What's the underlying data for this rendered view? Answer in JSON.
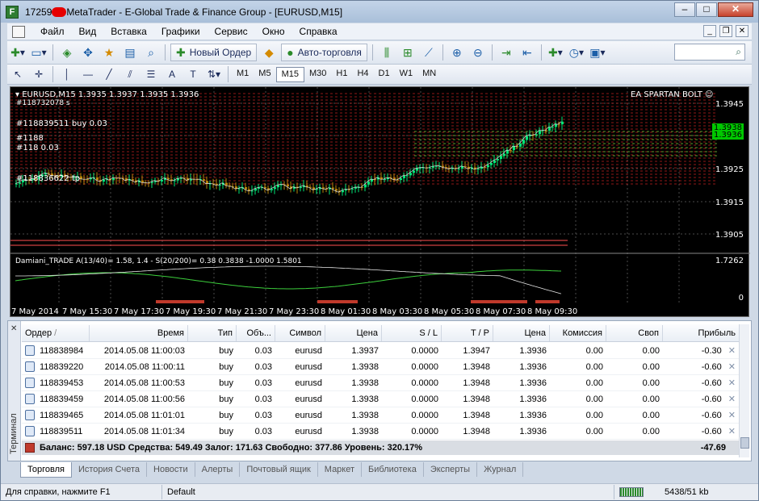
{
  "window": {
    "title_prefix": "17259",
    "title_rest": "MetaTrader - E-Global Trade & Finance Group - [EURUSD,M15]"
  },
  "menu": [
    "Файл",
    "Вид",
    "Вставка",
    "Графики",
    "Сервис",
    "Окно",
    "Справка"
  ],
  "toolbar": {
    "new_order": "Новый Ордер",
    "autotrading": "Авто-торговля",
    "timeframes": [
      "M1",
      "M5",
      "M15",
      "M30",
      "H1",
      "H4",
      "D1",
      "W1",
      "MN"
    ],
    "active_timeframe": "M15"
  },
  "chart": {
    "symbol_info": "EURUSD,M15  1.3935 1.3937 1.3935 1.3936",
    "ea_name": "EA SPARTAN BOLT",
    "order_labels": [
      "#118732078 s",
      "#118839511 buy 0.03",
      "#1188",
      "#118 0.03",
      "#118836622 tp"
    ],
    "price_labels": [
      "1.3945",
      "1.3938",
      "1.3936",
      "1.3925",
      "1.3915",
      "1.3905"
    ],
    "indicator_label": "Damiani_TRADE  A(13/40)= 1.58, 1.4 - S(20/200)= 0.38  0.3838 -1.0000 1.5801",
    "indicator_scale": [
      "1.7262",
      "0"
    ],
    "time_labels": [
      "7 May 2014",
      "7 May 15:30",
      "7 May 17:30",
      "7 May 19:30",
      "7 May 21:30",
      "7 May 23:30",
      "8 May 01:30",
      "8 May 03:30",
      "8 May 05:30",
      "8 May 07:30",
      "8 May 09:30"
    ]
  },
  "terminal": {
    "side_label": "Терминал",
    "columns": [
      "Ордер",
      "Время",
      "Тип",
      "Объ...",
      "Символ",
      "Цена",
      "S / L",
      "T / P",
      "Цена",
      "Комиссия",
      "Своп",
      "Прибыль"
    ],
    "rows": [
      {
        "order": "118838984",
        "time": "2014.05.08 11:00:03",
        "type": "buy",
        "volume": "0.03",
        "symbol": "eurusd",
        "price": "1.3937",
        "sl": "0.0000",
        "tp": "1.3947",
        "cur": "1.3936",
        "commission": "0.00",
        "swap": "0.00",
        "profit": "-0.30"
      },
      {
        "order": "118839220",
        "time": "2014.05.08 11:00:11",
        "type": "buy",
        "volume": "0.03",
        "symbol": "eurusd",
        "price": "1.3938",
        "sl": "0.0000",
        "tp": "1.3948",
        "cur": "1.3936",
        "commission": "0.00",
        "swap": "0.00",
        "profit": "-0.60"
      },
      {
        "order": "118839453",
        "time": "2014.05.08 11:00:53",
        "type": "buy",
        "volume": "0.03",
        "symbol": "eurusd",
        "price": "1.3938",
        "sl": "0.0000",
        "tp": "1.3948",
        "cur": "1.3936",
        "commission": "0.00",
        "swap": "0.00",
        "profit": "-0.60"
      },
      {
        "order": "118839459",
        "time": "2014.05.08 11:00:56",
        "type": "buy",
        "volume": "0.03",
        "symbol": "eurusd",
        "price": "1.3938",
        "sl": "0.0000",
        "tp": "1.3948",
        "cur": "1.3936",
        "commission": "0.00",
        "swap": "0.00",
        "profit": "-0.60"
      },
      {
        "order": "118839465",
        "time": "2014.05.08 11:01:01",
        "type": "buy",
        "volume": "0.03",
        "symbol": "eurusd",
        "price": "1.3938",
        "sl": "0.0000",
        "tp": "1.3948",
        "cur": "1.3936",
        "commission": "0.00",
        "swap": "0.00",
        "profit": "-0.60"
      },
      {
        "order": "118839511",
        "time": "2014.05.08 11:01:34",
        "type": "buy",
        "volume": "0.03",
        "symbol": "eurusd",
        "price": "1.3938",
        "sl": "0.0000",
        "tp": "1.3948",
        "cur": "1.3936",
        "commission": "0.00",
        "swap": "0.00",
        "profit": "-0.60"
      }
    ],
    "balance_text": "Баланс: 597.18 USD  Средства: 549.49  Залог: 171.63  Свободно: 377.86  Уровень: 320.17%",
    "total_profit": "-47.69",
    "tabs": [
      "Торговля",
      "История Счета",
      "Новости",
      "Алерты",
      "Почтовый ящик",
      "Маркет",
      "Библиотека",
      "Эксперты",
      "Журнал"
    ],
    "active_tab": "Торговля"
  },
  "statusbar": {
    "help": "Для справки, нажмите F1",
    "profile": "Default",
    "traffic": "5438/51 kb"
  },
  "colors": {
    "bull": "#00e676",
    "bear": "#b8860b",
    "grid": "#4a4a4a",
    "order_line": "#ff2d2d"
  }
}
